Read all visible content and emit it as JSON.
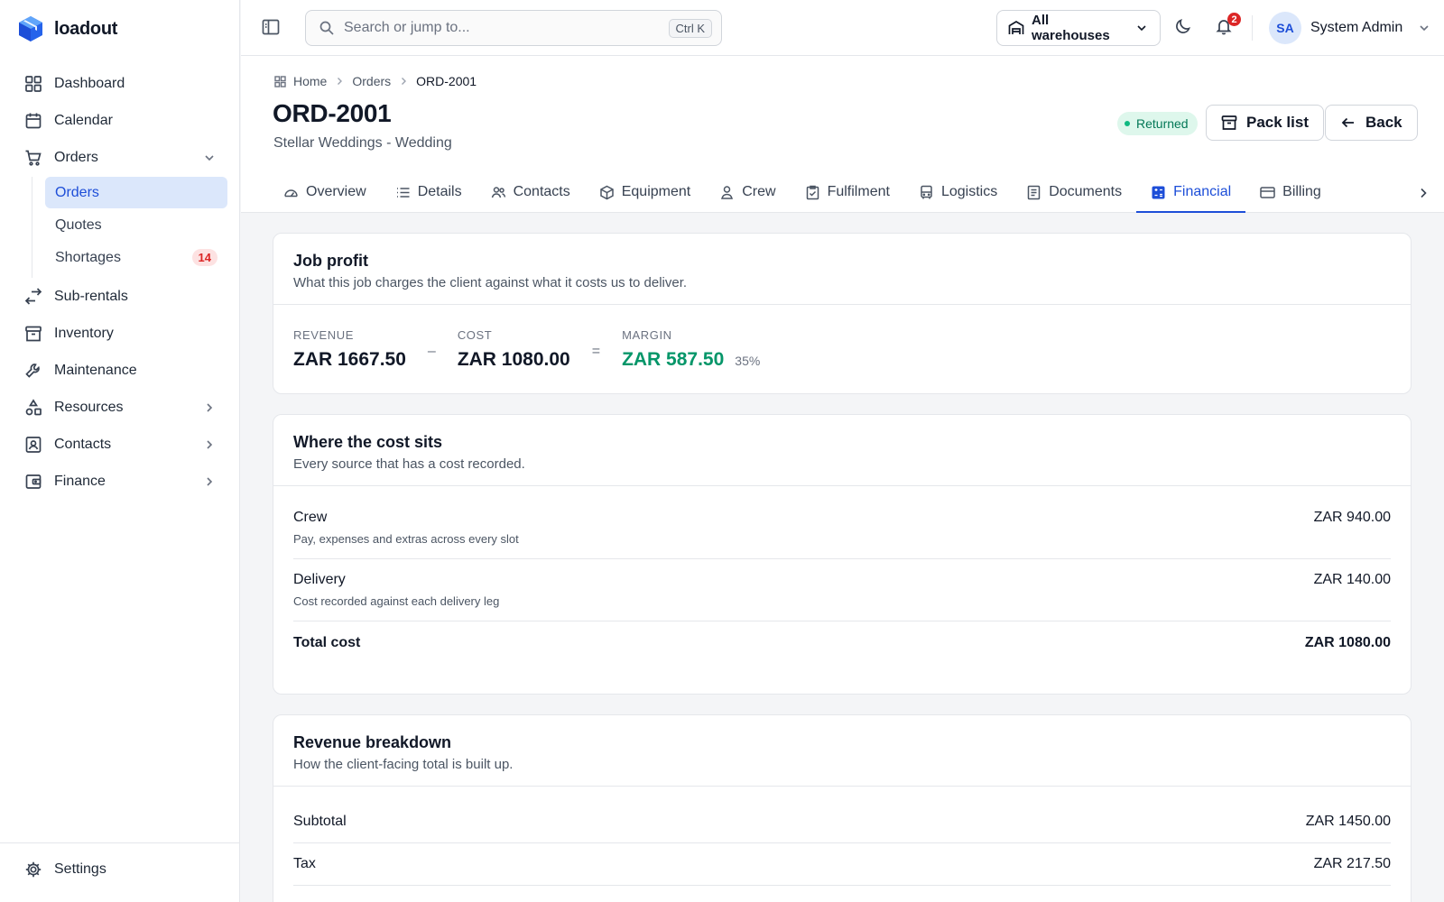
{
  "app": {
    "name": "loadout"
  },
  "sidebar": {
    "items": [
      {
        "label": "Dashboard",
        "icon": "grid-icon"
      },
      {
        "label": "Calendar",
        "icon": "calendar-icon"
      },
      {
        "label": "Orders",
        "icon": "cart-icon",
        "expanded": true
      },
      {
        "label": "Sub-rentals",
        "icon": "arrows-swap-icon"
      },
      {
        "label": "Inventory",
        "icon": "archive-icon"
      },
      {
        "label": "Maintenance",
        "icon": "wrench-icon"
      },
      {
        "label": "Resources",
        "icon": "shapes-icon"
      },
      {
        "label": "Contacts",
        "icon": "contact-card-icon"
      },
      {
        "label": "Finance",
        "icon": "wallet-icon"
      }
    ],
    "orders_sub": [
      {
        "label": "Orders",
        "active": true
      },
      {
        "label": "Quotes"
      },
      {
        "label": "Shortages",
        "badge": "14"
      }
    ],
    "settings": "Settings"
  },
  "topbar": {
    "search_placeholder": "Search or jump to...",
    "search_shortcut": "Ctrl K",
    "warehouse": "All warehouses",
    "notifications": "2",
    "user_initials": "SA",
    "user_name": "System Admin"
  },
  "breadcrumb": [
    "Home",
    "Orders",
    "ORD-2001"
  ],
  "page": {
    "title": "ORD-2001",
    "subtitle": "Stellar Weddings - Wedding",
    "status": "Returned",
    "pack_list": "Pack list",
    "back": "Back"
  },
  "tabs": [
    {
      "label": "Overview",
      "icon": "gauge-icon"
    },
    {
      "label": "Details",
      "icon": "list-icon"
    },
    {
      "label": "Contacts",
      "icon": "users-icon"
    },
    {
      "label": "Equipment",
      "icon": "box-icon"
    },
    {
      "label": "Crew",
      "icon": "user-icon"
    },
    {
      "label": "Fulfilment",
      "icon": "clipboard-check-icon"
    },
    {
      "label": "Logistics",
      "icon": "bus-icon"
    },
    {
      "label": "Documents",
      "icon": "document-icon"
    },
    {
      "label": "Financial",
      "icon": "calculator-icon",
      "active": true
    },
    {
      "label": "Billing",
      "icon": "credit-card-icon"
    }
  ],
  "job_profit": {
    "title": "Job profit",
    "description": "What this job charges the client against what it costs us to deliver.",
    "revenue_label": "REVENUE",
    "revenue": "ZAR 1667.50",
    "minus": "–",
    "cost_label": "COST",
    "cost": "ZAR 1080.00",
    "equals": "=",
    "margin_label": "MARGIN",
    "margin": "ZAR 587.50",
    "margin_pct": "35%",
    "colors": {
      "margin": "#059669"
    }
  },
  "cost": {
    "title": "Where the cost sits",
    "description": "Every source that has a cost recorded.",
    "rows": [
      {
        "name": "Crew",
        "desc": "Pay, expenses and extras across every slot",
        "value": "ZAR 940.00"
      },
      {
        "name": "Delivery",
        "desc": "Cost recorded against each delivery leg",
        "value": "ZAR 140.00"
      }
    ],
    "total_label": "Total cost",
    "total_value": "ZAR 1080.00"
  },
  "revenue": {
    "title": "Revenue breakdown",
    "description": "How the client-facing total is built up.",
    "rows": [
      {
        "name": "Subtotal",
        "value": "ZAR 1450.00"
      },
      {
        "name": "Tax",
        "value": "ZAR 217.50"
      }
    ]
  },
  "colors": {
    "accent": "#1d4ed8",
    "danger": "#dc2626",
    "success": "#059669"
  }
}
